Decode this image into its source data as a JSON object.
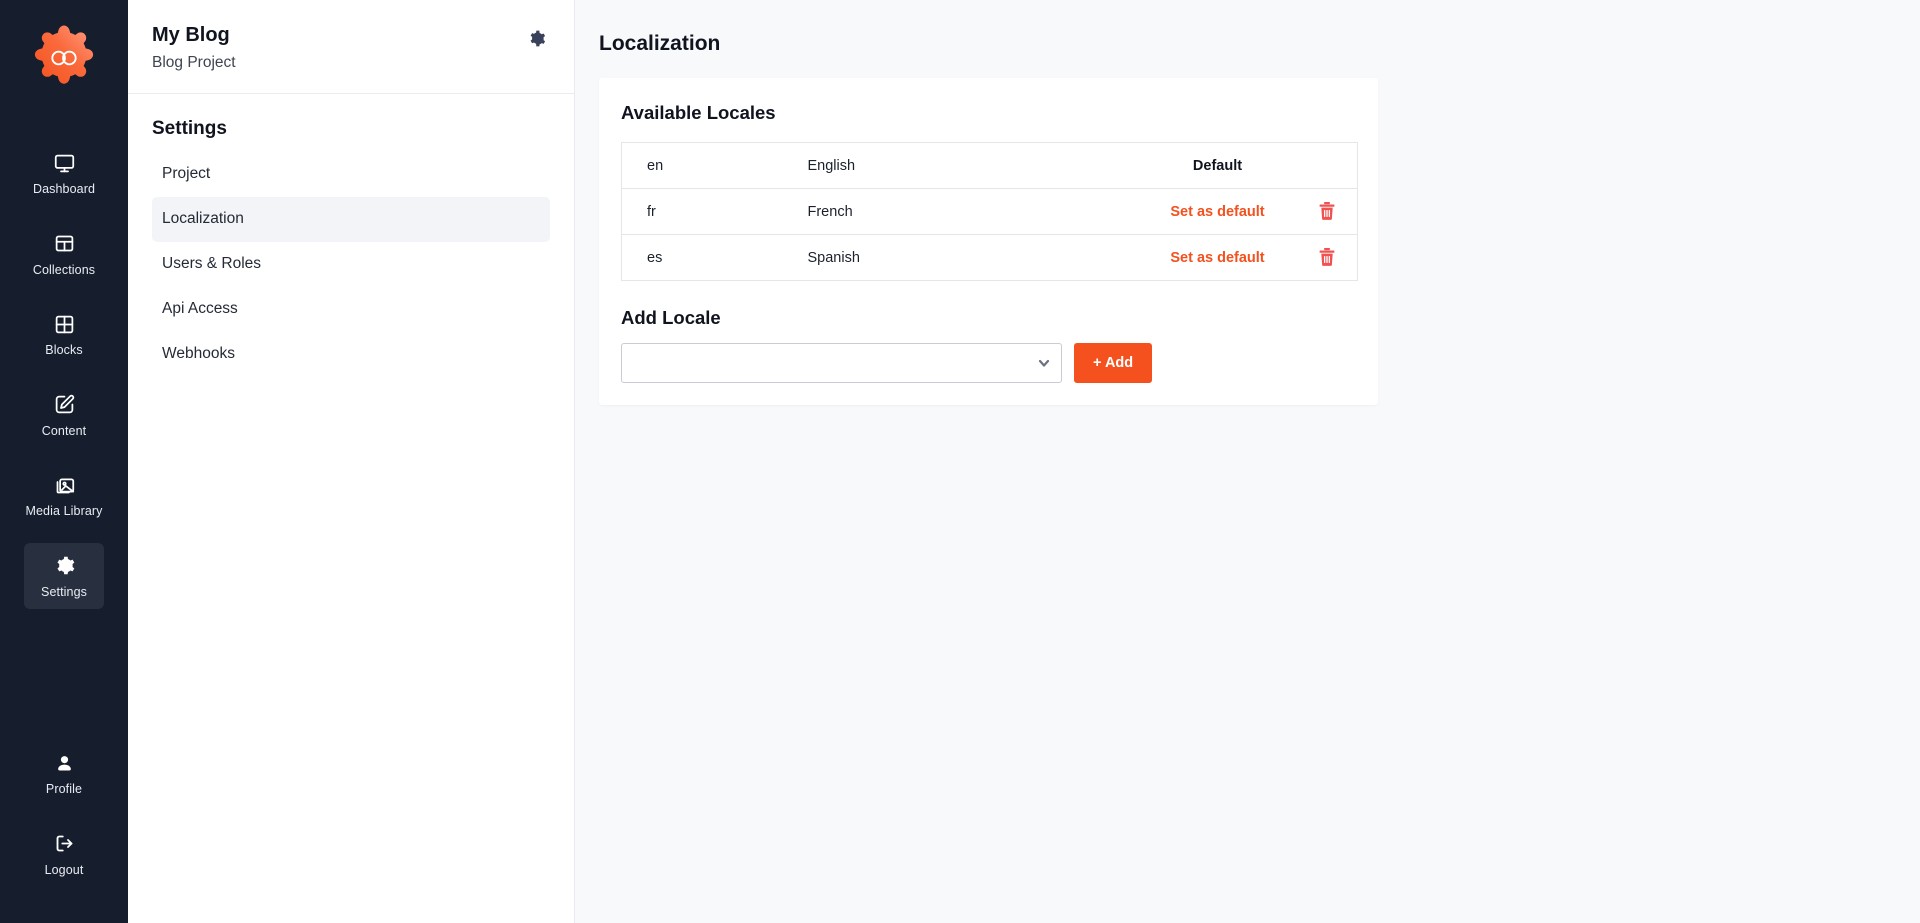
{
  "rail": {
    "logo_icon": "gear-infinity-logo",
    "items": [
      {
        "label": "Dashboard",
        "icon": "monitor-icon",
        "active": false
      },
      {
        "label": "Collections",
        "icon": "table-grid-icon",
        "active": false
      },
      {
        "label": "Blocks",
        "icon": "blocks-grid-icon",
        "active": false
      },
      {
        "label": "Content",
        "icon": "edit-square-icon",
        "active": false
      },
      {
        "label": "Media Library",
        "icon": "image-stack-icon",
        "active": false
      },
      {
        "label": "Settings",
        "icon": "gear-icon",
        "active": true
      }
    ],
    "bottom_items": [
      {
        "label": "Profile",
        "icon": "user-icon"
      },
      {
        "label": "Logout",
        "icon": "logout-icon"
      }
    ]
  },
  "settings_panel": {
    "project_title": "My Blog",
    "project_subtitle": "Blog Project",
    "gear_icon": "gear-icon",
    "section_title": "Settings",
    "nav": [
      {
        "label": "Project",
        "active": false
      },
      {
        "label": "Localization",
        "active": true
      },
      {
        "label": "Users & Roles",
        "active": false
      },
      {
        "label": "Api Access",
        "active": false
      },
      {
        "label": "Webhooks",
        "active": false
      }
    ]
  },
  "main": {
    "page_title": "Localization",
    "card_title": "Available Locales",
    "locales": [
      {
        "code": "en",
        "name": "English",
        "action": "Default",
        "is_default": true,
        "deletable": false
      },
      {
        "code": "fr",
        "name": "French",
        "action": "Set as default",
        "is_default": false,
        "deletable": true
      },
      {
        "code": "es",
        "name": "Spanish",
        "action": "Set as default",
        "is_default": false,
        "deletable": true
      }
    ],
    "delete_icon": "trash-icon",
    "add_locale": {
      "title": "Add Locale",
      "select_value": "",
      "select_placeholder": "",
      "chevron_icon": "chevron-down-icon",
      "add_button_label": "+ Add"
    }
  },
  "colors": {
    "rail_bg": "#161d2d",
    "rail_active": "#28303f",
    "accent_orange": "#f4511e",
    "danger_red": "#f05252",
    "page_bg": "#f8f9fb",
    "card_bg": "#ffffff",
    "nav_active_bg": "#f2f4f7"
  }
}
